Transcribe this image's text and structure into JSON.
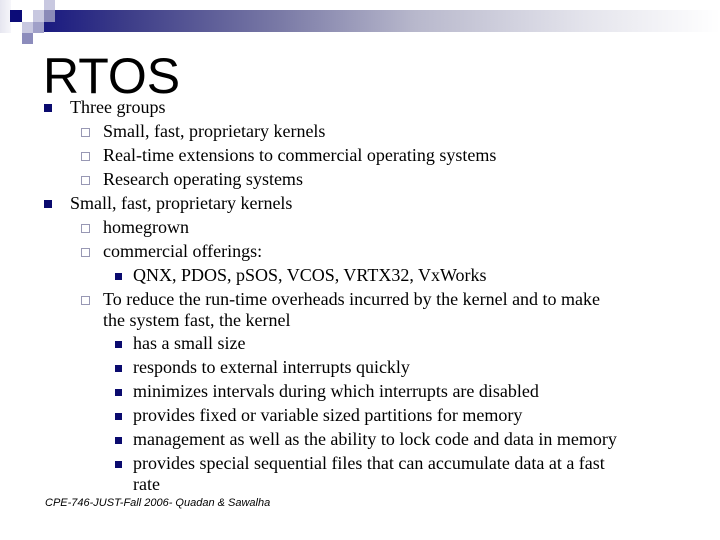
{
  "slide": {
    "title": "RTOS",
    "bullets": [
      {
        "text": "Three groups",
        "children": [
          {
            "text": "Small, fast, proprietary kernels"
          },
          {
            "text": "Real-time extensions to commercial operating systems"
          },
          {
            "text": "Research operating systems"
          }
        ]
      },
      {
        "text": "Small, fast, proprietary kernels",
        "children": [
          {
            "text": "homegrown"
          },
          {
            "text": "commercial offerings:",
            "children": [
              {
                "text": "QNX, PDOS, pSOS, VCOS, VRTX32, VxWorks"
              }
            ]
          },
          {
            "text_line1": "To reduce the run-time overheads incurred by the kernel and to make",
            "text_line2": "the system fast, the kernel",
            "children": [
              {
                "text": "has a small size"
              },
              {
                "text": "responds to external interrupts quickly"
              },
              {
                "text": "minimizes intervals during which interrupts are disabled"
              },
              {
                "text": "provides fixed or variable sized partitions for memory"
              },
              {
                "text": "management as well as the ability to lock code and data in memory"
              },
              {
                "text_line1": "provides special sequential files that can accumulate data at a fast",
                "text_line2": "rate"
              }
            ]
          }
        ]
      }
    ],
    "footer": "CPE-746-JUST-Fall 2006- Quadan & Sawalha"
  },
  "theme": {
    "bullet_primary": "#0a0a6e",
    "bullet_secondary": "#9898b4",
    "banner_start": "#1a1a80"
  }
}
